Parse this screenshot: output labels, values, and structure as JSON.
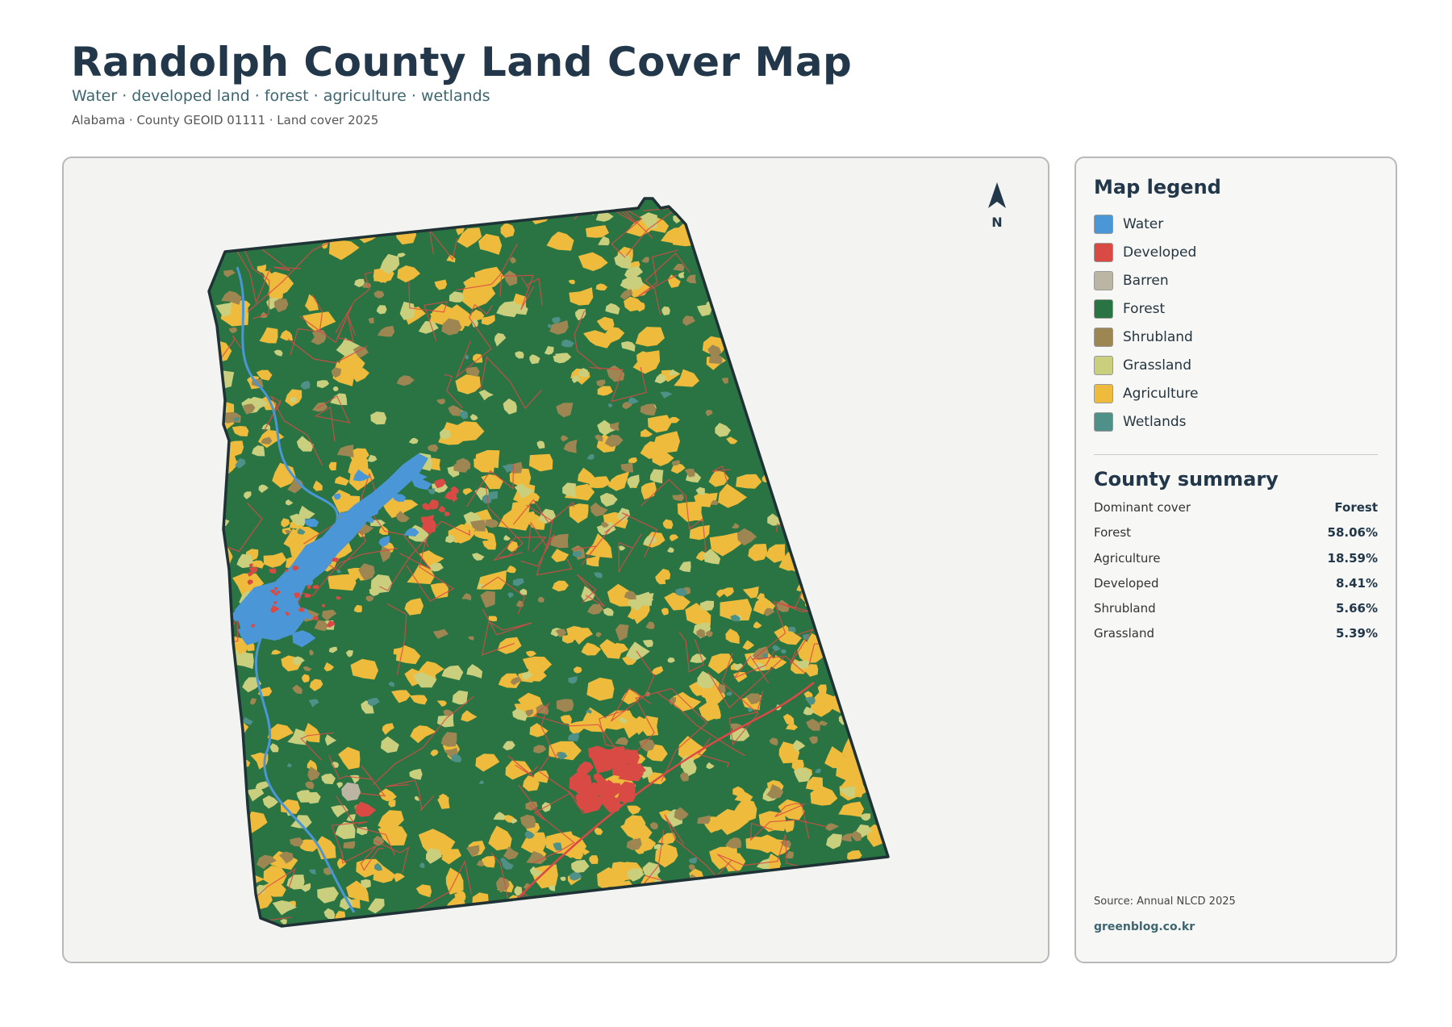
{
  "header": {
    "title": "Randolph County Land Cover Map",
    "subtitle": "Water · developed land · forest · agriculture · wetlands",
    "meta": "Alabama · County GEOID 01111 · Land cover 2025"
  },
  "map": {
    "north_label": "N",
    "colors": {
      "water": "#4a96d6",
      "developed": "#d94a44",
      "barren": "#bdb5a3",
      "forest": "#2a7444",
      "shrubland": "#9e8653",
      "grassland": "#c9cf7d",
      "agriculture": "#efbb3c",
      "wetlands": "#4f9189",
      "outline": "#1f3236"
    }
  },
  "legend": {
    "title": "Map legend",
    "items": [
      {
        "label": "Water",
        "color": "#4a96d6"
      },
      {
        "label": "Developed",
        "color": "#d94a44"
      },
      {
        "label": "Barren",
        "color": "#bdb5a3"
      },
      {
        "label": "Forest",
        "color": "#2a7444"
      },
      {
        "label": "Shrubland",
        "color": "#9e8653"
      },
      {
        "label": "Grassland",
        "color": "#c9cf7d"
      },
      {
        "label": "Agriculture",
        "color": "#efbb3c"
      },
      {
        "label": "Wetlands",
        "color": "#4f9189"
      }
    ]
  },
  "summary": {
    "title": "County summary",
    "rows": [
      {
        "label": "Dominant cover",
        "value": "Forest"
      },
      {
        "label": "Forest",
        "value": "58.06%"
      },
      {
        "label": "Agriculture",
        "value": "18.59%"
      },
      {
        "label": "Developed",
        "value": "8.41%"
      },
      {
        "label": "Shrubland",
        "value": "5.66%"
      },
      {
        "label": "Grassland",
        "value": "5.39%"
      }
    ]
  },
  "footer": {
    "source": "Source: Annual NLCD 2025",
    "site": "greenblog.co.kr"
  }
}
